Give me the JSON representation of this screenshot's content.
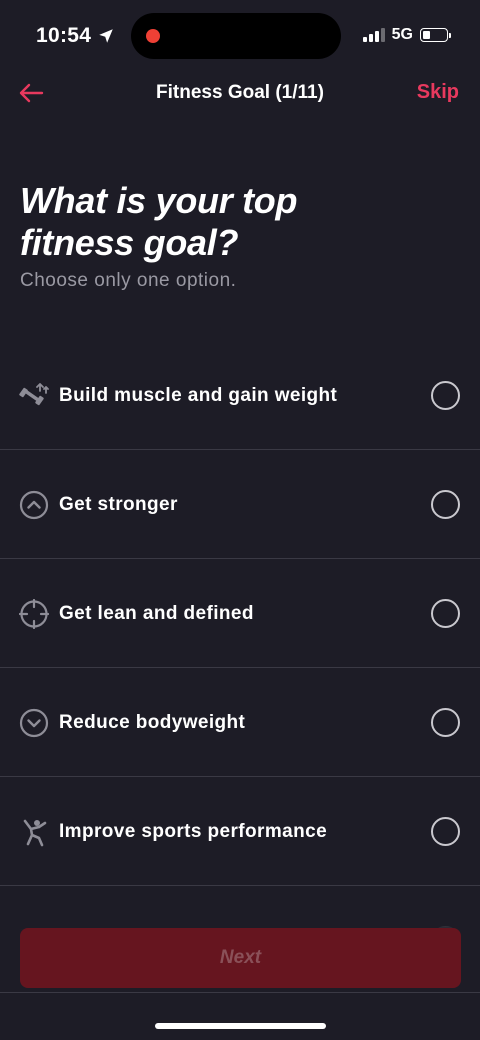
{
  "status_bar": {
    "time": "10:54",
    "network": "5G",
    "battery_level": 0.3,
    "location_icon": "location-arrow-icon",
    "recording_color": "#ee4035"
  },
  "header": {
    "title": "Fitness Goal (1/11)",
    "back_icon": "arrow-left-icon",
    "skip_label": "Skip"
  },
  "question": {
    "title": "What is your top fitness goal?",
    "subtitle": "Choose only one option."
  },
  "options": [
    {
      "label": "Build muscle and gain weight",
      "icon": "dumbbell-arrows-icon",
      "selected": false
    },
    {
      "label": "Get stronger",
      "icon": "chevron-up-circle-icon",
      "selected": false
    },
    {
      "label": "Get lean and defined",
      "icon": "crosshair-icon",
      "selected": false
    },
    {
      "label": "Reduce bodyweight",
      "icon": "chevron-down-circle-icon",
      "selected": false
    },
    {
      "label": "Improve sports performance",
      "icon": "athlete-running-icon",
      "selected": false
    }
  ],
  "next_button": {
    "label": "Next",
    "enabled": false
  },
  "colors": {
    "background": "#1d1c26",
    "accent": "#e8395e",
    "button_disabled": "#66151f",
    "divider": "#3a3944"
  }
}
